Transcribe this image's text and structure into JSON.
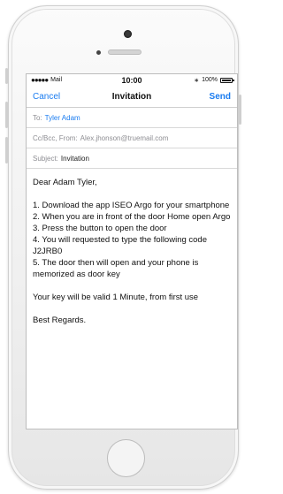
{
  "status_bar": {
    "carrier_dots": "●●●●●",
    "carrier": "Mail",
    "time": "10:00",
    "bluetooth": "∗",
    "battery": "100%"
  },
  "nav": {
    "cancel": "Cancel",
    "title": "Invitation",
    "send": "Send"
  },
  "fields": {
    "to_label": "To:",
    "to_value": "Tyler Adam",
    "ccbcc_label": "Cc/Bcc, From:",
    "ccbcc_value": "Alex.jhonson@truemail.com",
    "subject_label": "Subject:",
    "subject_value": "Invitation"
  },
  "message": {
    "greeting": "Dear Adam Tyler,",
    "steps": [
      "1. Download the app ISEO Argo for your smartphone",
      "2. When you are in front of the door Home open Argo",
      "3. Press the button to open the door",
      "4. You will requested to type the following code J2JRB0",
      "5. The door then will open and your phone is memorized as door key"
    ],
    "validity": "Your key will be valid 1 Minute, from first use",
    "closing": "Best Regards."
  }
}
